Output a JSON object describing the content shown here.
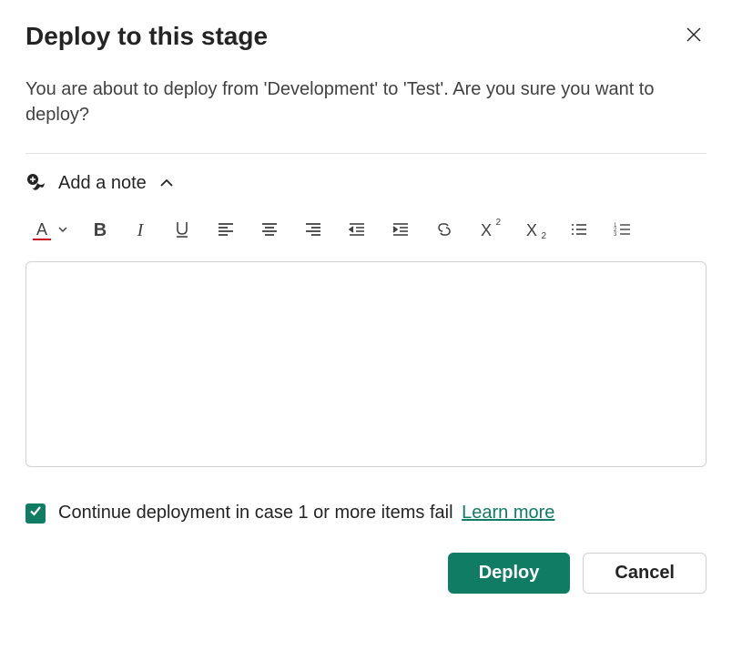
{
  "dialog": {
    "title": "Deploy to this stage",
    "description": "You are about to deploy from 'Development' to 'Test'. Are you sure you want to deploy?"
  },
  "addNote": {
    "label": "Add a note"
  },
  "toolbar": {
    "fontColor": "A",
    "bold": "B",
    "italic": "I",
    "superscript_base": "X",
    "superscript_exp": "2",
    "subscript_base": "X",
    "subscript_sub": "2"
  },
  "editor": {
    "value": "",
    "placeholder": ""
  },
  "checkbox": {
    "checked": true,
    "label": "Continue deployment in case 1 or more items fail",
    "learnMore": "Learn more"
  },
  "footer": {
    "primary": "Deploy",
    "secondary": "Cancel"
  }
}
